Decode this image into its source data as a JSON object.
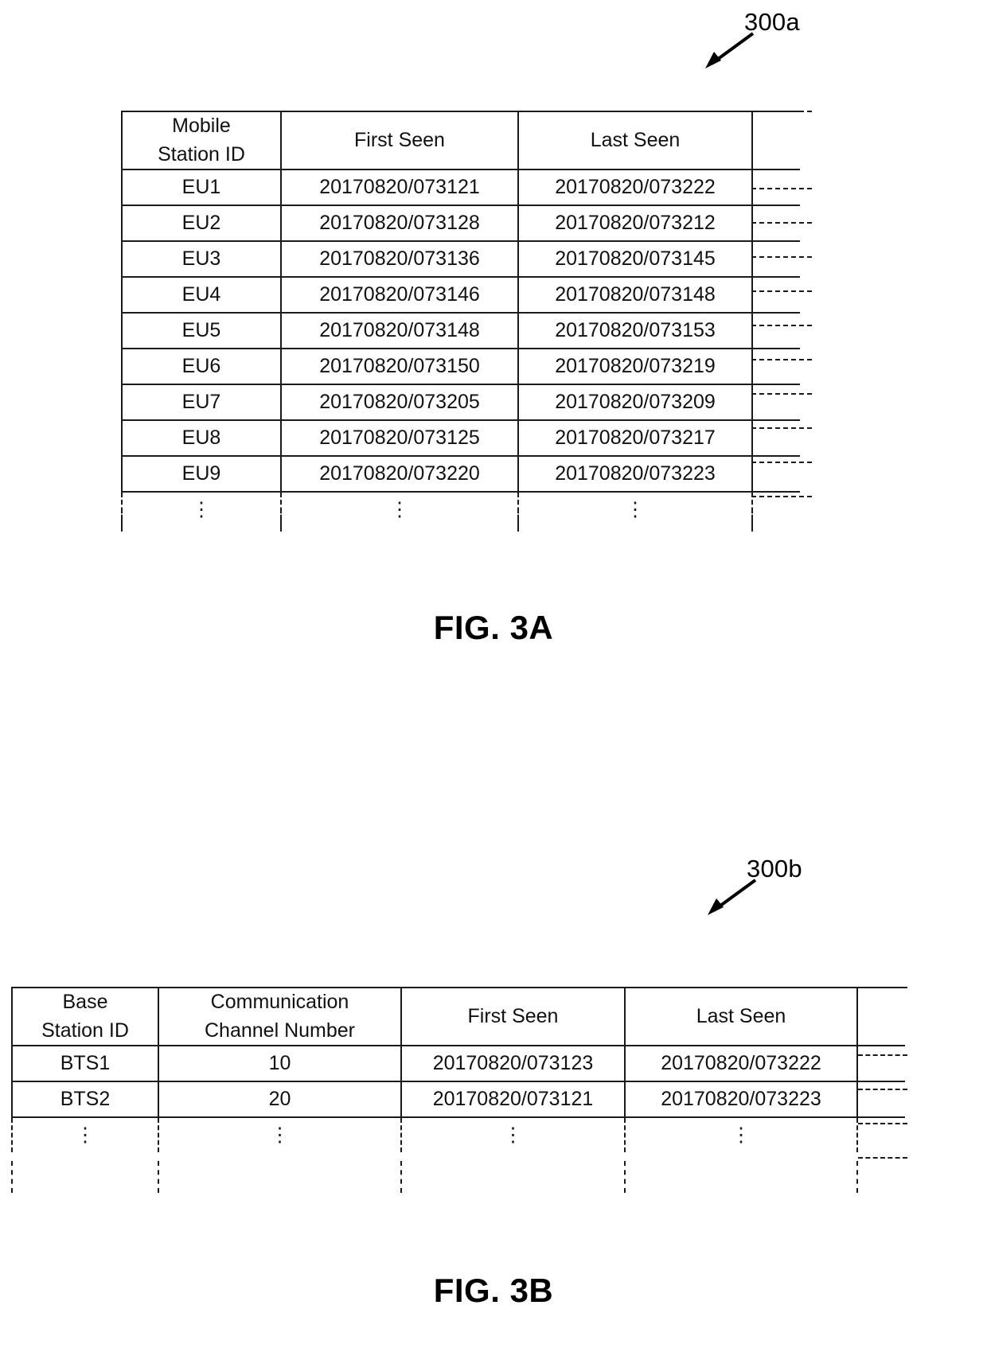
{
  "figures": [
    {
      "id": "fig-3a",
      "caption": "FIG. 3A",
      "callout": "300a",
      "table": {
        "name": "mobile-station-table",
        "headers": [
          {
            "lines": [
              "Mobile",
              "Station ID"
            ]
          },
          {
            "lines": [
              "First Seen"
            ]
          },
          {
            "lines": [
              "Last Seen"
            ]
          }
        ],
        "rows": [
          [
            "EU1",
            "20170820/073121",
            "20170820/073222"
          ],
          [
            "EU2",
            "20170820/073128",
            "20170820/073212"
          ],
          [
            "EU3",
            "20170820/073136",
            "20170820/073145"
          ],
          [
            "EU4",
            "20170820/073146",
            "20170820/073148"
          ],
          [
            "EU5",
            "20170820/073148",
            "20170820/073153"
          ],
          [
            "EU6",
            "20170820/073150",
            "20170820/073219"
          ],
          [
            "EU7",
            "20170820/073205",
            "20170820/073209"
          ],
          [
            "EU8",
            "20170820/073125",
            "20170820/073217"
          ],
          [
            "EU9",
            "20170820/073220",
            "20170820/073223"
          ]
        ],
        "continuation_symbol": "⋮"
      }
    },
    {
      "id": "fig-3b",
      "caption": "FIG. 3B",
      "callout": "300b",
      "table": {
        "name": "base-station-table",
        "headers": [
          {
            "lines": [
              "Base",
              "Station ID"
            ]
          },
          {
            "lines": [
              "Communication",
              "Channel Number"
            ]
          },
          {
            "lines": [
              "First Seen"
            ]
          },
          {
            "lines": [
              "Last Seen"
            ]
          }
        ],
        "rows": [
          [
            "BTS1",
            "10",
            "20170820/073123",
            "20170820/073222"
          ],
          [
            "BTS2",
            "20",
            "20170820/073121",
            "20170820/073223"
          ]
        ],
        "continuation_symbol": "⋮"
      }
    }
  ]
}
